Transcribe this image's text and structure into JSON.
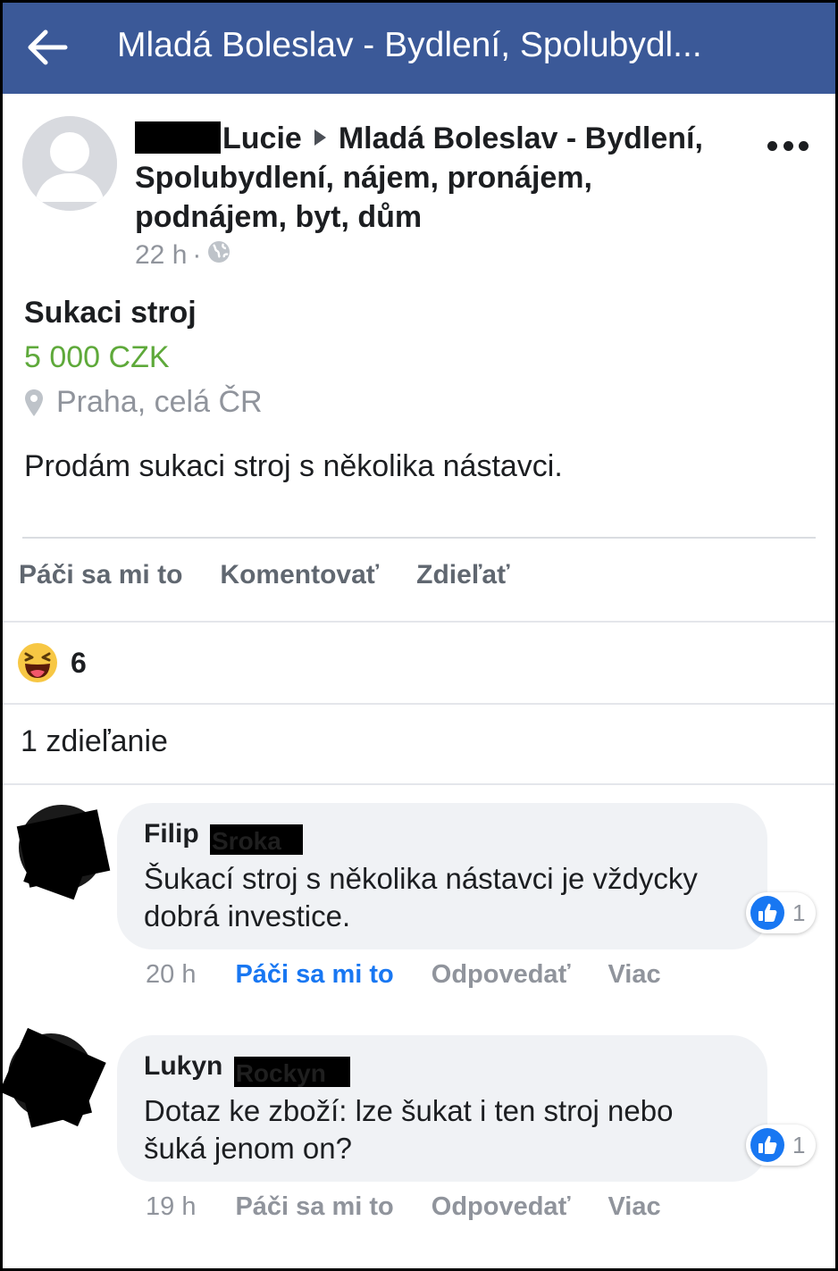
{
  "header": {
    "title": "Mladá Boleslav - Bydlení, Spolubydl..."
  },
  "post": {
    "author": "Lucie",
    "group": "Mladá Boleslav - Bydlení, Spolubydlení, nájem, pronájem, podnájem, byt, dům",
    "time": "22 h",
    "separator": "·"
  },
  "listing": {
    "title": "Sukaci stroj",
    "price": "5 000 CZK",
    "location": "Praha, celá ČR",
    "description": "Prodám sukaci stroj s několika nástavci."
  },
  "actions": {
    "like": "Páči sa mi to",
    "comment": "Komentovať",
    "share": "Zdieľať"
  },
  "reactions": {
    "count": "6"
  },
  "shares": {
    "text": "1 zdieľanie"
  },
  "comments": [
    {
      "name": "Filip",
      "redacted_surname": "Sroka",
      "text": "Šukací stroj s několika nástavci je vždycky dobrá investice.",
      "likes": "1",
      "time": "20 h",
      "like": "Páči sa mi to",
      "reply": "Odpovedať",
      "more": "Viac"
    },
    {
      "name": "Lukyn",
      "redacted_surname": "Rockyn",
      "text": "Dotaz ke zboží: lze šukat i ten stroj nebo šuká jenom on?",
      "likes": "1",
      "time": "19 h",
      "like": "Páči sa mi to",
      "reply": "Odpovedať",
      "more": "Viac"
    }
  ],
  "colors": {
    "header_bg": "#3b5998",
    "price": "#5ea93a",
    "liked": "#1877f2"
  }
}
